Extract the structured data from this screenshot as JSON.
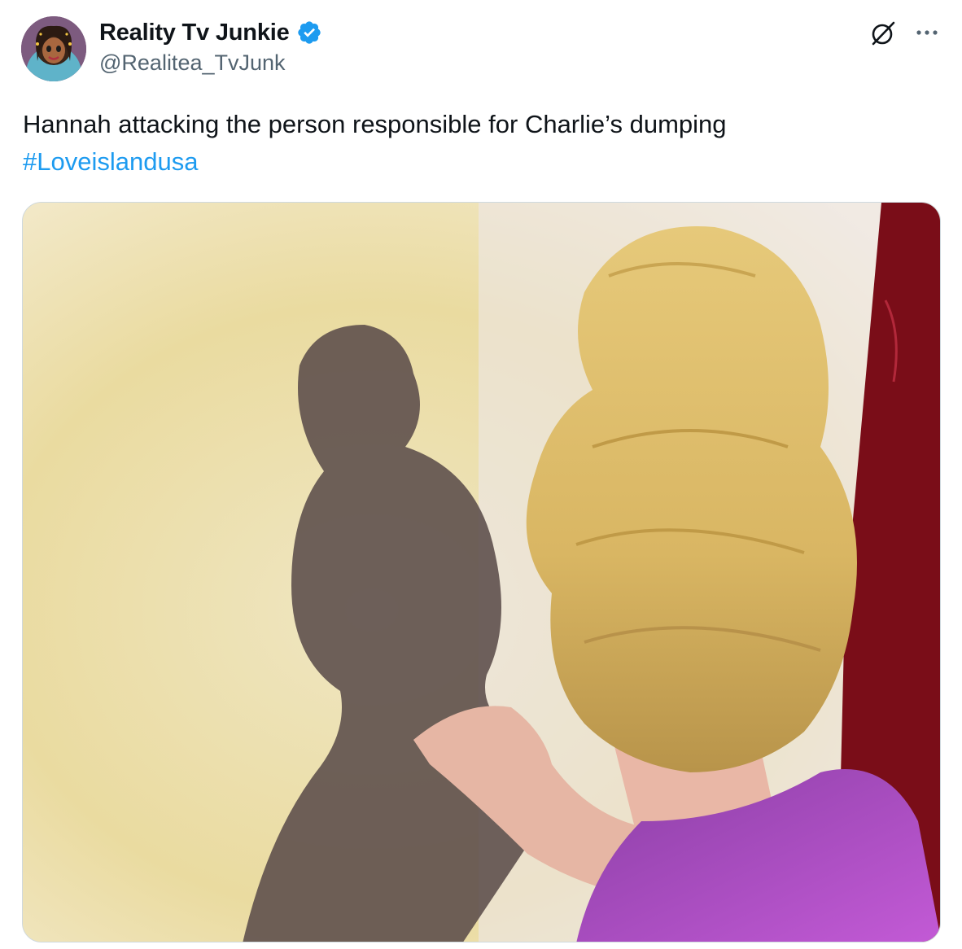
{
  "author": {
    "display_name": "Reality Tv Junkie",
    "handle": "@Realitea_TvJunk",
    "verified": true,
    "avatar_icon": "cartoon-avatar"
  },
  "tweet": {
    "text": "Hannah attacking the person responsible for Charlie’s dumping",
    "hashtag": "#Loveislandusa"
  },
  "actions": {
    "grok_icon": "grok-icon",
    "more_icon": "more-options-icon"
  },
  "colors": {
    "text": "#0f1419",
    "secondary_text": "#536471",
    "link": "#1d9bf0",
    "verified": "#1d9bf0",
    "border": "#cfd9de"
  }
}
